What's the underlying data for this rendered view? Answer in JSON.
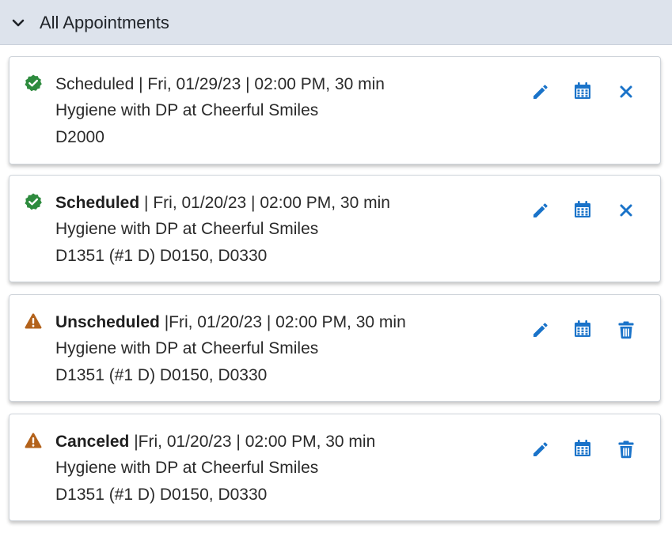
{
  "header": {
    "title": "All Appointments"
  },
  "colors": {
    "accent": "#1a73c9",
    "success": "#2e8b3e",
    "warning": "#b3621b",
    "header_bg": "#dde3ec"
  },
  "appointments": [
    {
      "status": "Scheduled",
      "status_icon": "check-badge-icon",
      "status_bold": false,
      "details": " | Fri, 01/29/23 | 02:00 PM, 30 min",
      "description": "Hygiene with DP at Cheerful Smiles",
      "codes": "D2000",
      "third_action": "close-icon"
    },
    {
      "status": "Scheduled",
      "status_icon": "check-badge-icon",
      "status_bold": true,
      "details": " | Fri, 01/20/23 | 02:00 PM, 30 min",
      "description": "Hygiene with DP at Cheerful Smiles",
      "codes": "D1351 (#1 D) D0150, D0330",
      "third_action": "close-icon"
    },
    {
      "status": "Unscheduled",
      "status_icon": "warning-icon",
      "status_bold": true,
      "details": " |Fri, 01/20/23 | 02:00 PM, 30 min",
      "description": "Hygiene with DP at Cheerful Smiles",
      "codes": "D1351 (#1 D) D0150, D0330",
      "third_action": "trash-icon"
    },
    {
      "status": "Canceled",
      "status_icon": "warning-icon",
      "status_bold": true,
      "details": " |Fri, 01/20/23 | 02:00 PM, 30 min",
      "description": "Hygiene with DP at Cheerful Smiles",
      "codes": "D1351 (#1 D) D0150, D0330",
      "third_action": "trash-icon"
    }
  ]
}
